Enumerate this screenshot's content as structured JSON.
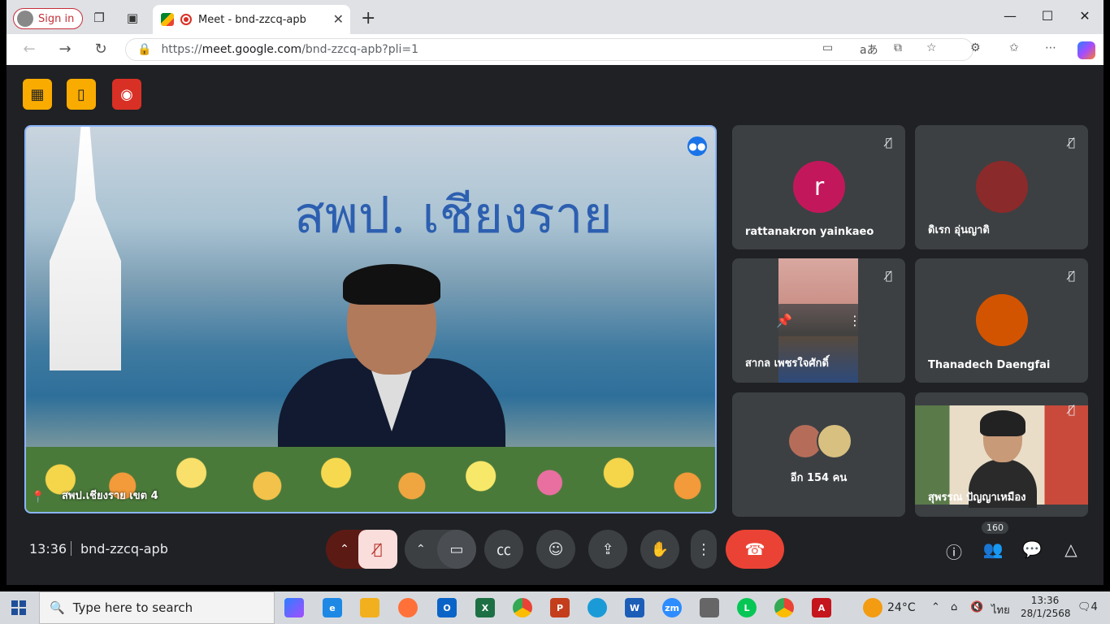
{
  "browser": {
    "signin_label": "Sign in",
    "tab_title": "Meet - bnd-zzcq-apb",
    "url_prefix": "https://",
    "url_host": "meet.google.com",
    "url_path": "/bnd-zzcq-apb?pli=1"
  },
  "meeting": {
    "main_speaker_name": "สพป.เชียงราย เขต 4",
    "banner_text": "สพป. เชียงราย",
    "time": "13:36",
    "code": "bnd-zzcq-apb",
    "participant_count": "160",
    "tiles": [
      {
        "name": "rattanakron yainkaeo",
        "avatar_letter": "r",
        "avatar_color": "#c2185b"
      },
      {
        "name": "ดิเรก อุ่นญาติ"
      },
      {
        "name": "สากล เพชรใจศักดิ์"
      },
      {
        "name": "Thanadech Daengfai"
      },
      {
        "name": "อีก 154 คน"
      },
      {
        "name": "สุพรรณ ปัญญาเหมือง"
      }
    ]
  },
  "taskbar": {
    "search_placeholder": "Type here to search",
    "weather": "24°C",
    "language": "ไทย",
    "time": "13:36",
    "date": "28/1/2568",
    "notifications": "4"
  },
  "icons": {
    "top_buttons": [
      "no-camera-grid-icon",
      "door-icon",
      "record-icon"
    ],
    "controls": [
      "mic-off-icon",
      "camera-icon",
      "captions-icon",
      "emoji-icon",
      "present-icon",
      "raise-hand-icon",
      "more-icon",
      "end-call-icon"
    ],
    "right_controls": [
      "info-icon",
      "people-icon",
      "chat-icon",
      "activities-icon"
    ]
  },
  "colors": {
    "meet_bg": "#202124",
    "tile_bg": "#3c4043",
    "end_call": "#ea4335",
    "active_speaker_border": "#8ab4f8",
    "top_btn_yellow": "#f9ab00",
    "top_btn_red": "#d93025"
  }
}
